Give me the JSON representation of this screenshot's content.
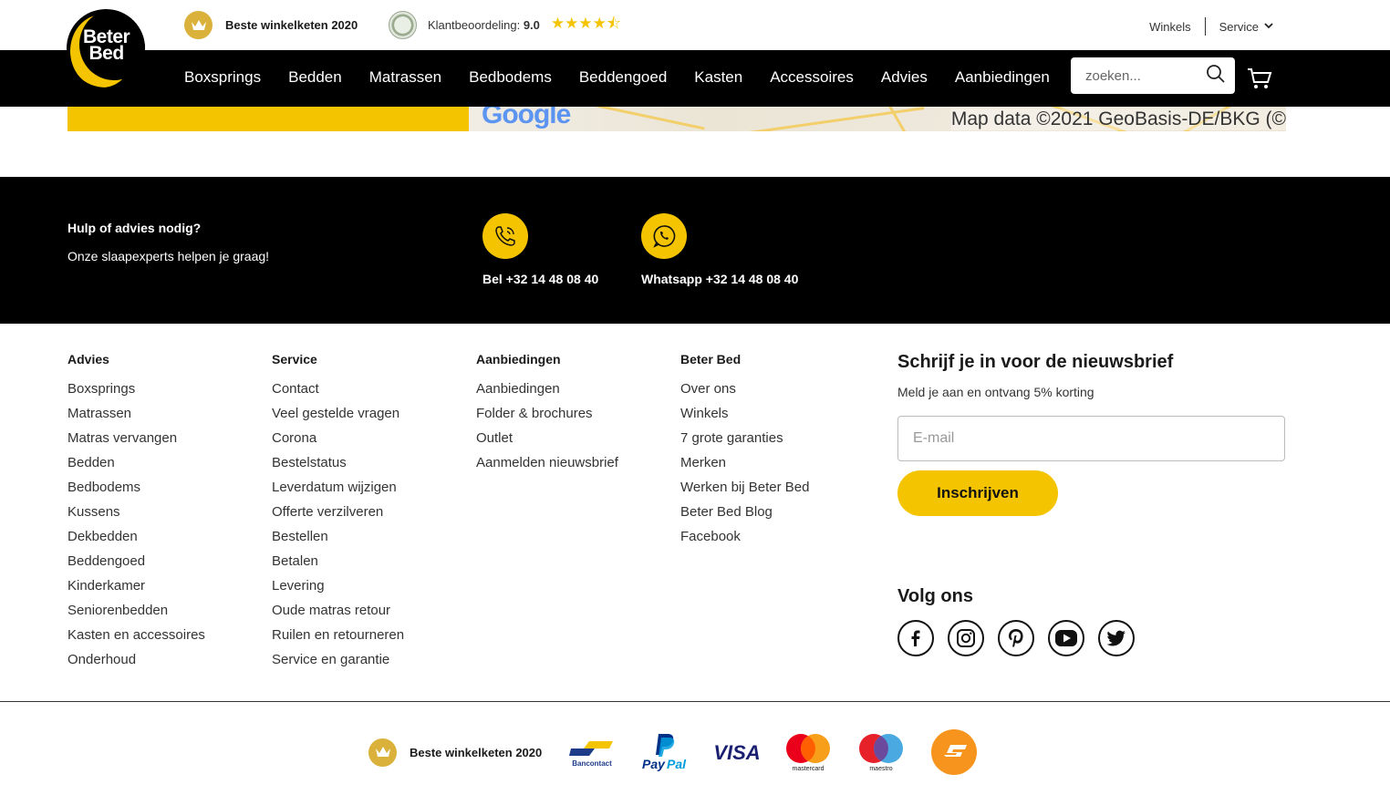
{
  "logo": {
    "line1": "Beter",
    "line2": "Bed"
  },
  "topbar": {
    "award": "Beste winkelketen 2020",
    "rating_label": "Klantbeoordeling:",
    "rating_value": "9.0",
    "stars": "★★★★⯪",
    "links": [
      "Winkels",
      "Service"
    ]
  },
  "nav": {
    "items": [
      "Boxsprings",
      "Bedden",
      "Matrassen",
      "Bedbodems",
      "Beddengoed",
      "Kasten",
      "Accessoires",
      "Advies",
      "Aanbiedingen"
    ],
    "search_placeholder": "zoeken..."
  },
  "map": {
    "google": "Google",
    "attribution": "Map data ©2021 GeoBasis-DE/BKG (©"
  },
  "help": {
    "title": "Hulp of advies nodig?",
    "subtitle": "Onze slaapexperts helpen je graag!",
    "call": "Bel +32 14 48 08 40",
    "whatsapp": "Whatsapp +32 14 48 08 40"
  },
  "footer": {
    "columns": [
      {
        "title": "Advies",
        "items": [
          "Boxsprings",
          "Matrassen",
          "Matras vervangen",
          "Bedden",
          "Bedbodems",
          "Kussens",
          "Dekbedden",
          "Beddengoed",
          "Kinderkamer",
          "Seniorenbedden",
          "Kasten en accessoires",
          "Onderhoud"
        ]
      },
      {
        "title": "Service",
        "items": [
          "Contact",
          "Veel gestelde vragen",
          "Corona",
          "Bestelstatus",
          "Leverdatum wijzigen",
          "Offerte verzilveren",
          "Bestellen",
          "Betalen",
          "Levering",
          "Oude matras retour",
          "Ruilen en retourneren",
          "Service en garantie"
        ]
      },
      {
        "title": "Aanbiedingen",
        "items": [
          "Aanbiedingen",
          "Folder & brochures",
          "Outlet",
          "Aanmelden nieuwsbrief"
        ]
      },
      {
        "title": "Beter Bed",
        "items": [
          "Over ons",
          "Winkels",
          "7 grote garanties",
          "Merken",
          "Werken bij Beter Bed",
          "Beter Bed Blog",
          "Facebook"
        ]
      }
    ],
    "newsletter": {
      "title": "Schrijf je in voor de nieuwsbrief",
      "subtitle": "Meld je aan en ontvang 5% korting",
      "email_placeholder": "E-mail",
      "button": "Inschrijven"
    },
    "follow": {
      "title": "Volg ons",
      "icons": [
        "facebook-icon",
        "instagram-icon",
        "pinterest-icon",
        "youtube-icon",
        "twitter-icon"
      ]
    }
  },
  "bottom": {
    "award": "Beste winkelketen 2020",
    "payments": {
      "bancontact": "Bancontact",
      "paypal_a": "Pay",
      "paypal_b": "Pal",
      "visa": "VISA",
      "mastercard": "mastercard",
      "maestro": "maestro"
    }
  },
  "colors": {
    "brand_yellow": "#f5c400",
    "black": "#000000",
    "crown_gold": "#d9b13b"
  }
}
